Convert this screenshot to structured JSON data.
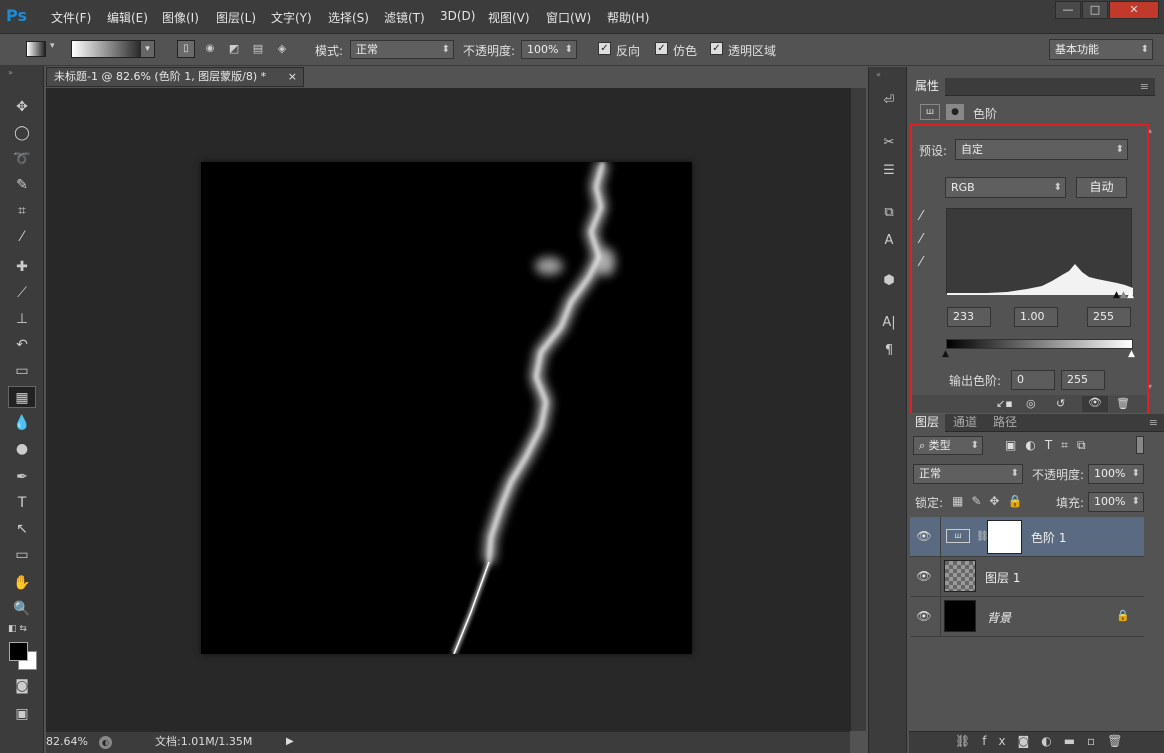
{
  "app": {
    "logo": "Ps"
  },
  "menu": [
    "文件(F)",
    "编辑(E)",
    "图像(I)",
    "图层(L)",
    "文字(Y)",
    "选择(S)",
    "滤镜(T)",
    "3D(D)",
    "视图(V)",
    "窗口(W)",
    "帮助(H)"
  ],
  "window_controls": {
    "minimize": "—",
    "maximize": "□",
    "close": "✕"
  },
  "options": {
    "mode_label": "模式:",
    "mode_value": "正常",
    "opacity_label": "不透明度:",
    "opacity_value": "100%",
    "reverse_label": "反向",
    "dither_label": "仿色",
    "transparency_label": "透明区域",
    "workspace": "基本功能"
  },
  "document": {
    "tab_title": "未标题-1 @ 82.6% (色阶 1, 图层蒙版/8) *",
    "close": "×",
    "zoom": "82.64%",
    "doc_info": "文档:1.01M/1.35M"
  },
  "properties": {
    "tab_label": "属性",
    "adjustment_name": "色阶",
    "preset_label": "预设:",
    "preset_value": "自定",
    "channel": "RGB",
    "auto_button": "自动",
    "input_black": "233",
    "input_gamma": "1.00",
    "input_white": "255",
    "output_label": "输出色阶:",
    "output_black": "0",
    "output_white": "255"
  },
  "layers_panel": {
    "tabs": [
      "图层",
      "通道",
      "路径"
    ],
    "filter_label": "类型",
    "blend_mode": "正常",
    "opacity_label": "不透明度:",
    "opacity_value": "100%",
    "lock_label": "锁定:",
    "fill_label": "填充:",
    "fill_value": "100%",
    "layers": [
      {
        "name": "色阶 1",
        "selected": true
      },
      {
        "name": "图层 1",
        "selected": false
      },
      {
        "name": "背景",
        "selected": false,
        "locked": true
      }
    ]
  },
  "colors": {
    "accent_red": "#e02020",
    "selected_layer": "#5a6a80"
  }
}
